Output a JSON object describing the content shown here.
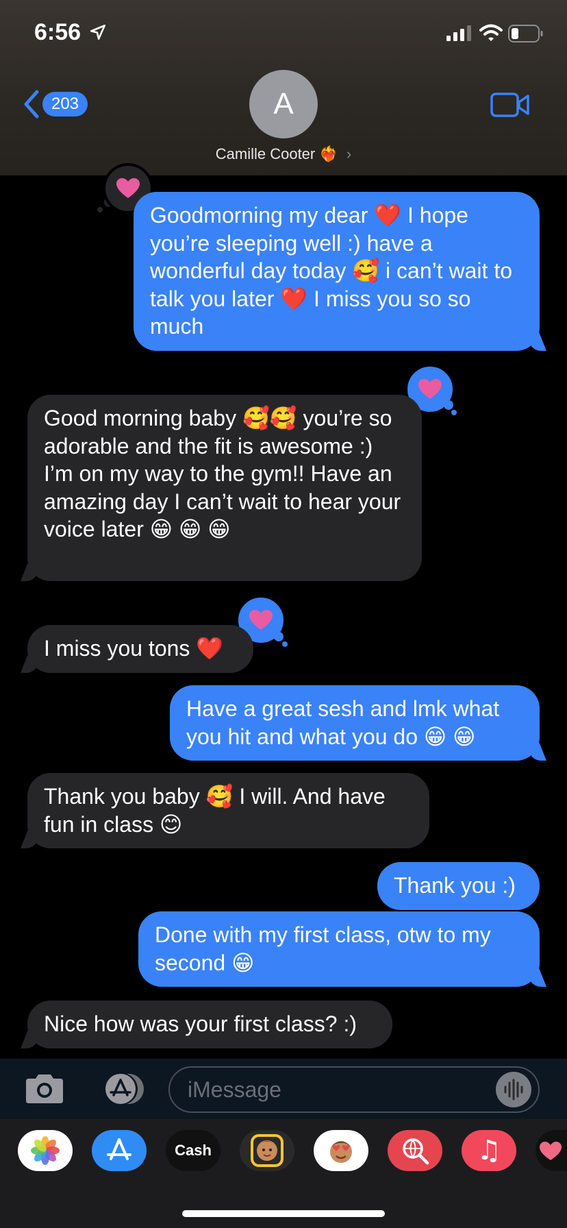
{
  "status_bar": {
    "time": "6:56"
  },
  "header": {
    "back_count": "203",
    "avatar_initial": "A",
    "contact_name": "Camille Cooter",
    "contact_emoji": "❤️‍🔥",
    "chevron": "›"
  },
  "messages": [
    {
      "direction": "sent",
      "text": "Goodmorning my dear ❤️ I hope you’re sleeping well :) have a wonderful day today 🥰 i can’t wait to talk you later ❤️ I miss you so so much",
      "tapback": "heart"
    },
    {
      "direction": "received",
      "text": "Good morning baby 🥰🥰 you’re so adorable and the fit is awesome :) I’m on my way to the gym!! Have an amazing day I can’t wait to hear your voice later 😁 😁 😁",
      "tapback": "heart"
    },
    {
      "direction": "received",
      "text": "I miss you tons ❤️",
      "tapback": "heart"
    },
    {
      "direction": "sent",
      "text": "Have a great sesh and lmk what you hit and what you do 😁 😁"
    },
    {
      "direction": "received",
      "text": "Thank you baby 🥰 I will. And have fun in class 😊"
    },
    {
      "direction": "sent",
      "text": "Thank you :)"
    },
    {
      "direction": "sent",
      "text": "Done with my first class, otw to my second 😁"
    },
    {
      "direction": "received",
      "text": "Nice how was your first class? :)"
    }
  ],
  "input": {
    "placeholder": "iMessage"
  },
  "app_drawer": [
    {
      "name": "photos-app-icon"
    },
    {
      "name": "app-store-app-icon"
    },
    {
      "name": "apple-cash-app-icon",
      "label": "Cash"
    },
    {
      "name": "memoji-app-icon"
    },
    {
      "name": "memoji-stickers-app-icon"
    },
    {
      "name": "web-images-app-icon"
    },
    {
      "name": "music-app-icon",
      "label": "♫"
    },
    {
      "name": "digital-touch-app-icon"
    }
  ],
  "colors": {
    "sent_bubble": "#3a82f7",
    "received_bubble": "#262628",
    "tapback_heart": "#ea5ca1"
  }
}
